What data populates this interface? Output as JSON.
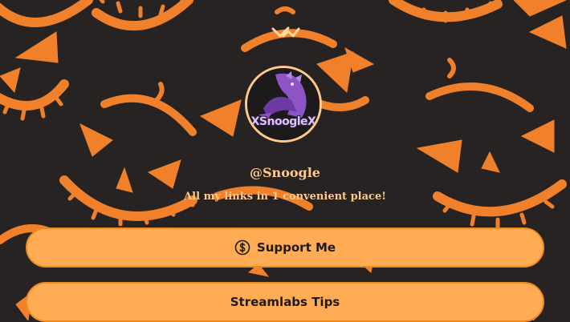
{
  "profile": {
    "avatar_text": "XSnoogleX",
    "username": "@Snoogle",
    "bio": "All my links in 1 convenient place!"
  },
  "links": [
    {
      "label": "Support Me",
      "icon": "dollar-circle-icon"
    },
    {
      "label": "Streamlabs Tips"
    }
  ],
  "colors": {
    "background": "#262322",
    "pumpkin_orange": "#f0802a",
    "button_fill": "#ffac54",
    "button_border": "#ee8a1e",
    "text_accent": "#ffc98b"
  }
}
